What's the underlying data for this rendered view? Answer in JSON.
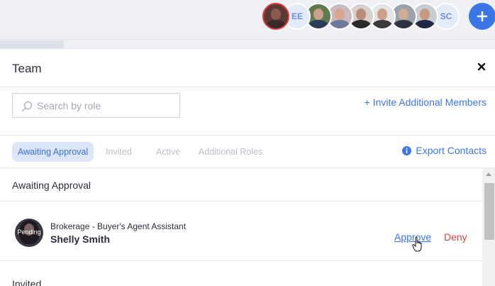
{
  "topbar": {
    "avatars": [
      {
        "kind": "photo",
        "skin": "#8a5a4e",
        "shirt": "#3b2a2a",
        "bg": "#5c3a34",
        "active": true
      },
      {
        "kind": "initials",
        "text": "EE"
      },
      {
        "kind": "photo",
        "skin": "#c9a08a",
        "shirt": "#2c3b5a",
        "bg": "#5f7a4e"
      },
      {
        "kind": "photo",
        "skin": "#d7a48e",
        "shirt": "#6b7a9a",
        "bg": "#c9b9c0"
      },
      {
        "kind": "photo",
        "skin": "#b98c78",
        "shirt": "#2a2a2a",
        "bg": "#d8d0d0"
      },
      {
        "kind": "photo",
        "skin": "#caa08a",
        "shirt": "#3a3a3a",
        "bg": "#e4e4e4"
      },
      {
        "kind": "photo",
        "skin": "#d2ab95",
        "shirt": "#2e3344",
        "bg": "#9aa2ad"
      },
      {
        "kind": "photo",
        "skin": "#c9987e",
        "shirt": "#1e2a44",
        "bg": "#c9ccd3"
      },
      {
        "kind": "initials",
        "text": "SC"
      }
    ],
    "add_icon": "plus-icon"
  },
  "panel": {
    "title": "Team",
    "close_icon": "close-icon",
    "search": {
      "placeholder": "Search by role",
      "value": "",
      "icon": "search-icon"
    },
    "invite_label": "+ Invite Additional Members",
    "tabs": [
      {
        "label": "Awaiting Approval",
        "selected": true
      },
      {
        "label": "Invited",
        "selected": false
      },
      {
        "label": "Active",
        "selected": false
      },
      {
        "label": "Additional Roles",
        "selected": false
      }
    ],
    "export_label": "Export Contacts",
    "export_icon": "info-icon",
    "awaiting_section": {
      "heading": "Awaiting Approval",
      "members": [
        {
          "status": "Pending",
          "role": "Brokerage - Buyer's Agent Assistant",
          "name": "Shelly Smith",
          "approve_label": "Approve",
          "deny_label": "Deny"
        }
      ]
    },
    "invited_section": {
      "heading": "Invited"
    }
  },
  "colors": {
    "accent": "#3a76e6",
    "deny": "#e04040",
    "selected_tab_bg": "#dbe6f9"
  }
}
